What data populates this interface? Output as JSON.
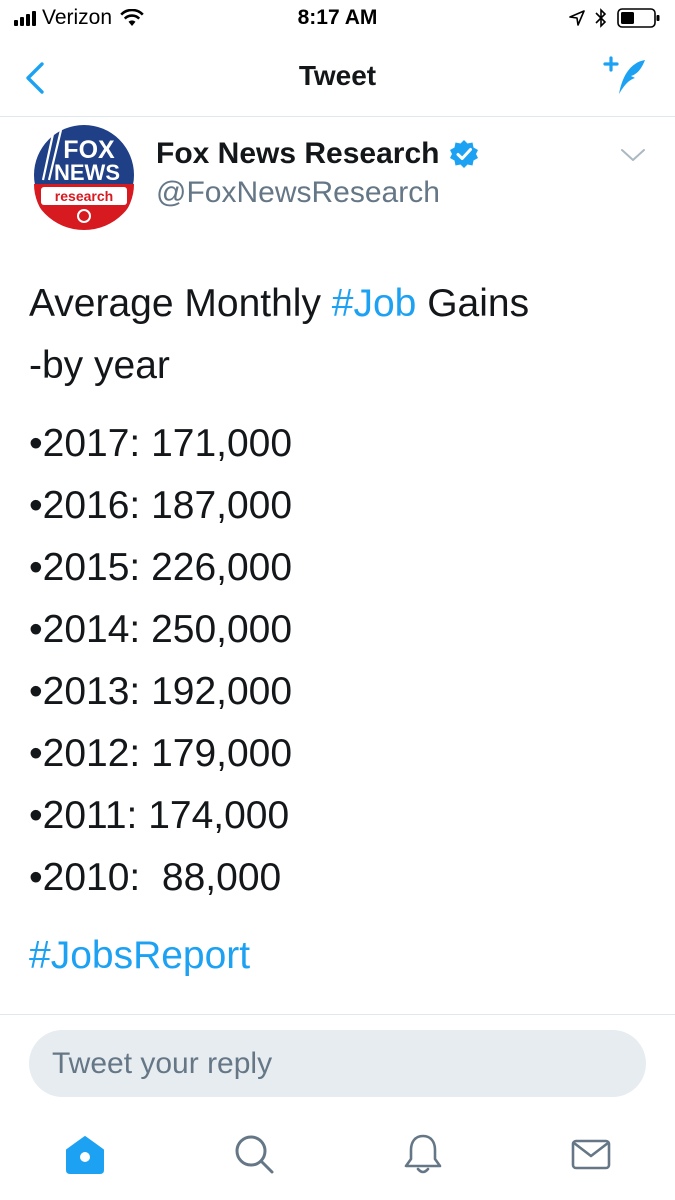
{
  "status_bar": {
    "carrier": "Verizon",
    "time": "8:17 AM",
    "icons": [
      "signal-bars-icon",
      "wifi-icon",
      "location-arrow-icon",
      "bluetooth-icon",
      "battery-icon"
    ]
  },
  "nav": {
    "title": "Tweet",
    "back_icon": "chevron-left-icon",
    "compose_icon": "compose-tweet-icon"
  },
  "tweet": {
    "author": {
      "name": "Fox News Research",
      "handle": "@FoxNewsResearch",
      "avatar_text": [
        "FOX",
        "NEWS",
        "research"
      ],
      "verified": true
    },
    "text": {
      "line1_pre": "Average Monthly ",
      "line1_hashtag": "#Job",
      "line1_post": " Gains",
      "line2": "-by year",
      "items": [
        "•2017: 171,000",
        "•2016: 187,000",
        "•2015: 226,000",
        "•2014: 250,000",
        "•2013: 192,000",
        "•2012: 179,000",
        "•2011: 174,000",
        "•2010:  88,000"
      ],
      "footer_hashtag": "#JobsReport"
    }
  },
  "reply": {
    "placeholder": "Tweet your reply"
  },
  "tab_bar": {
    "tabs": [
      "home-icon",
      "search-icon",
      "notifications-icon",
      "messages-icon"
    ],
    "active": "home-icon"
  },
  "colors": {
    "accent": "#1da1f2",
    "text": "#14171a",
    "secondary": "#657786",
    "reply_bg": "#e6ecf0"
  }
}
